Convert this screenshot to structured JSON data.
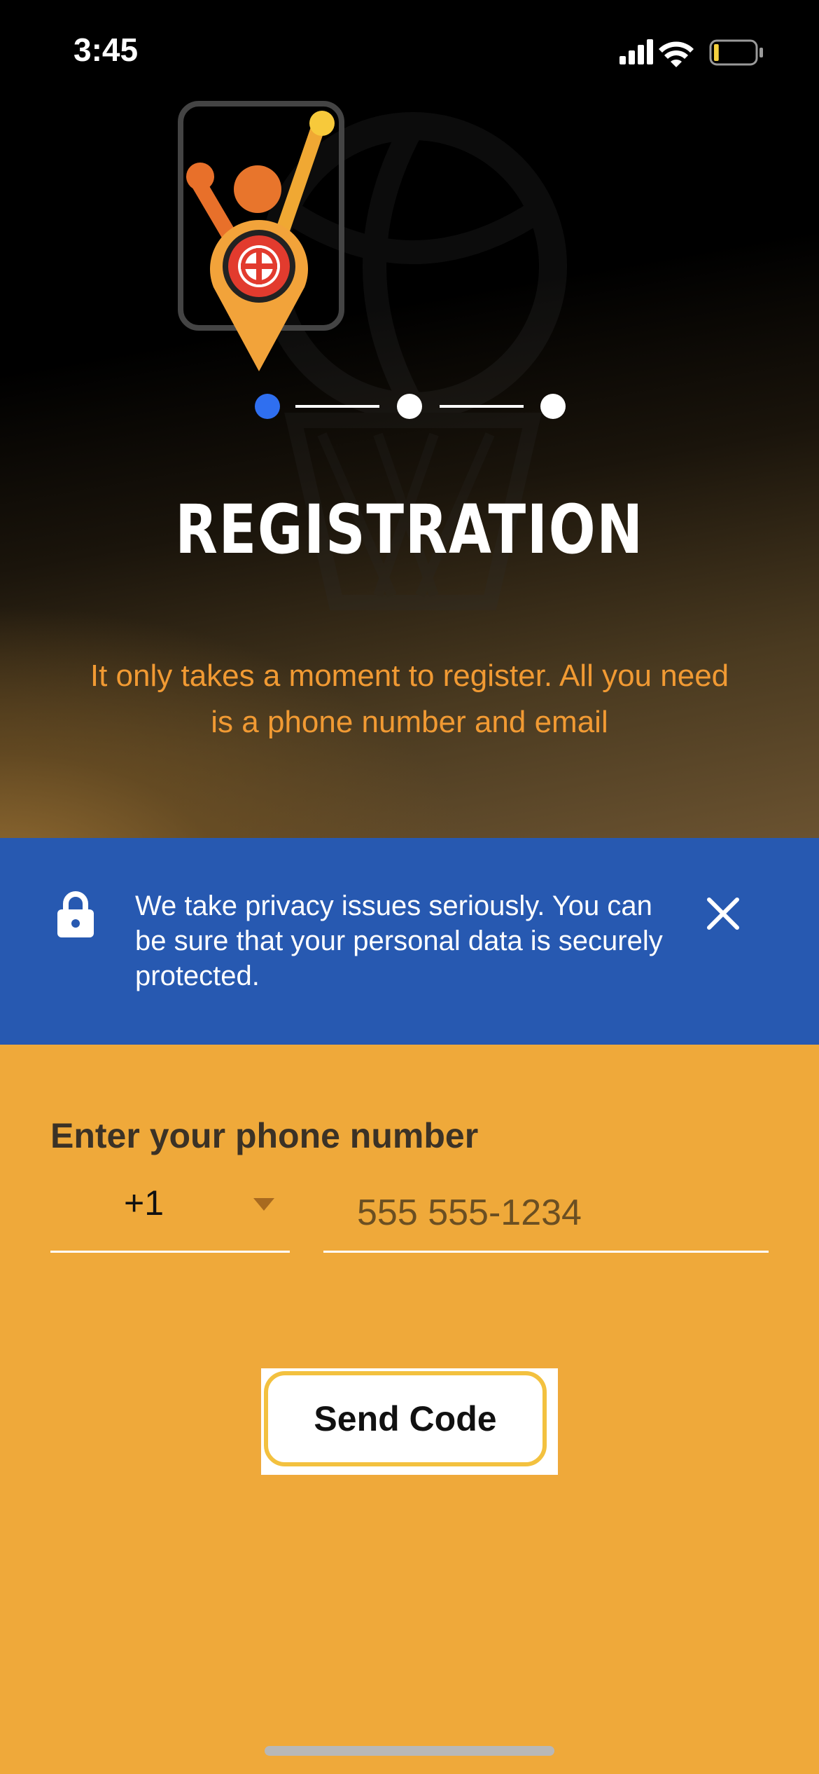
{
  "status_bar": {
    "time": "3:45",
    "battery_level": 0.12
  },
  "stepper": {
    "steps": 3,
    "current_step": 1,
    "active_color": "#2F6FF0"
  },
  "header": {
    "title": "REGISTRATION",
    "subtitle": "It only takes a moment to register. All you need is a phone number and email"
  },
  "privacy_banner": {
    "text": "We take privacy issues seriously. You can be sure that your personal data is securely protected.",
    "icon": "lock-icon",
    "close_icon": "close-icon",
    "background": "#2759B1"
  },
  "phone_form": {
    "label": "Enter your phone number",
    "country_code": "+1",
    "placeholder": "555 555-1234",
    "value": ""
  },
  "actions": {
    "send_code_label": "Send Code"
  },
  "colors": {
    "page_background": "#EFA93A",
    "subtitle": "#F19A33",
    "button_border": "#F3C13F"
  }
}
